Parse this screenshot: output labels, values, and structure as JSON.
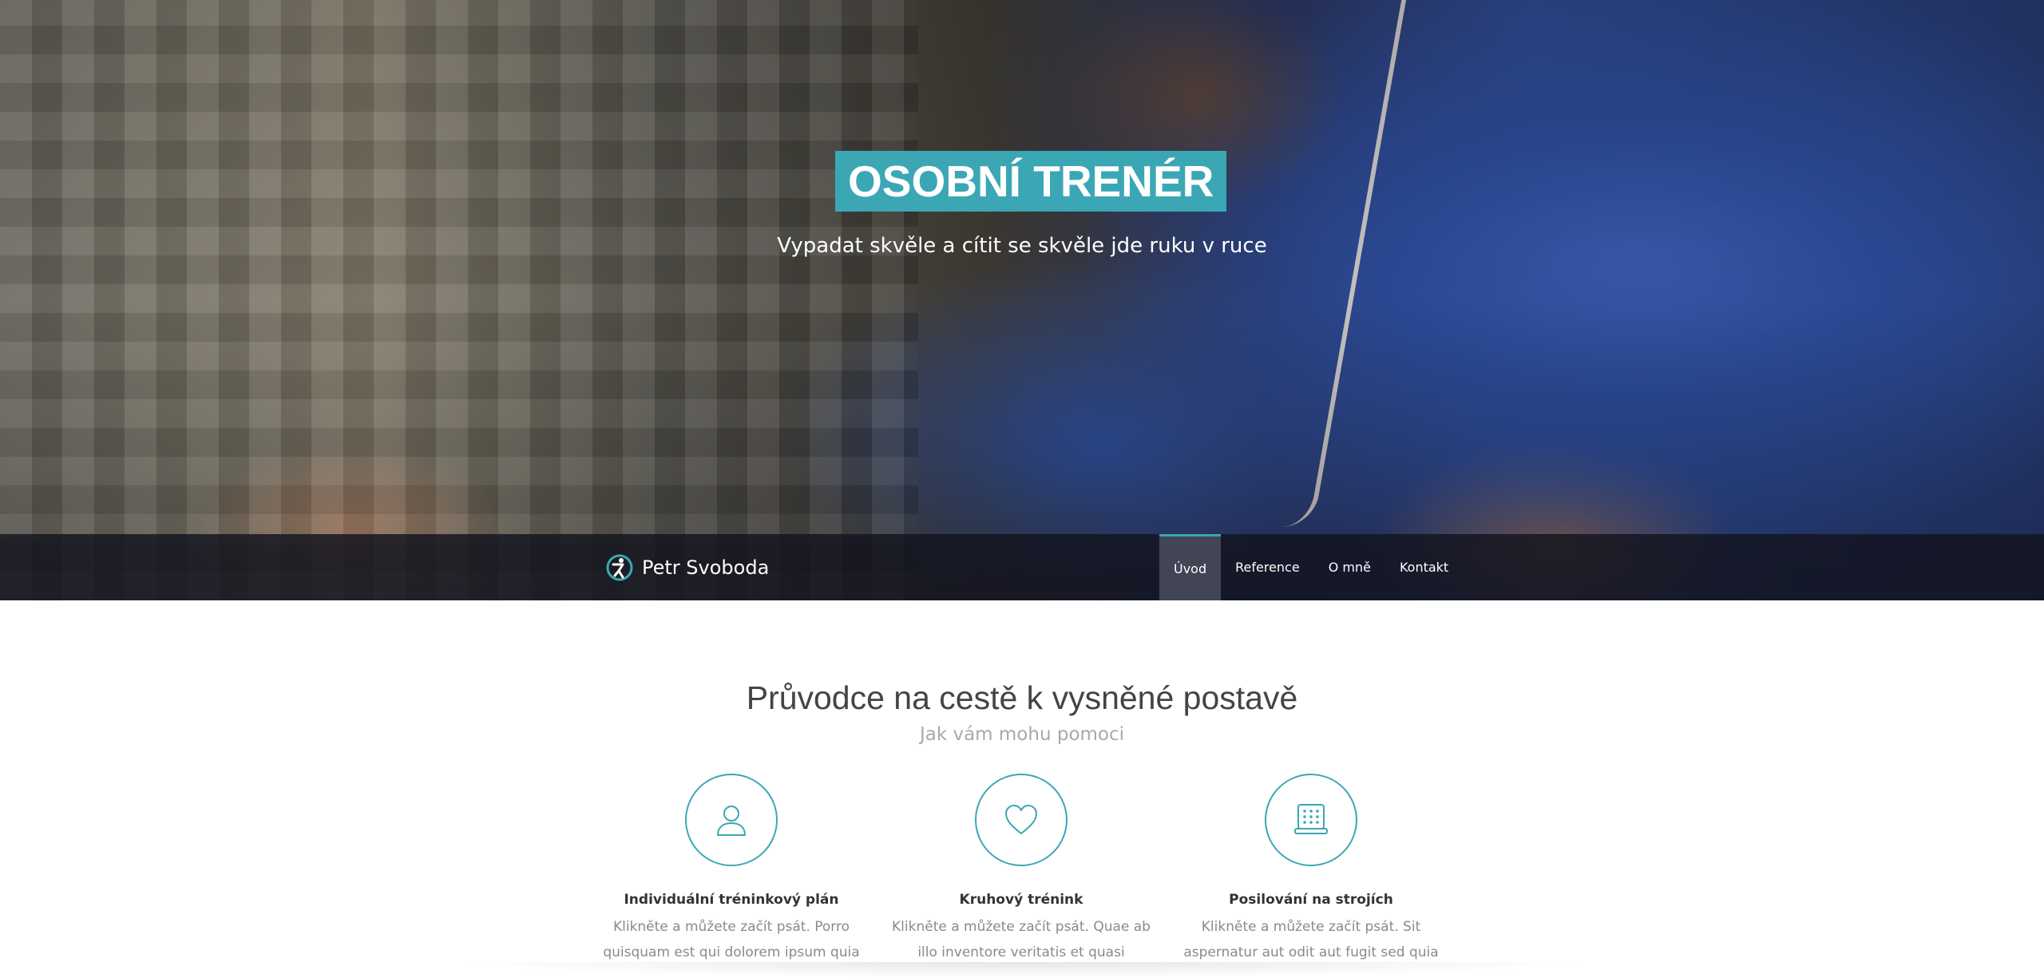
{
  "hero": {
    "title": "OSOBNÍ TRENÉR",
    "subtitle": "Vypadat skvěle a cítit se skvěle jde ruku v ruce"
  },
  "navbar": {
    "brand": "Petr Svoboda",
    "brand_icon": "runner-logo-icon",
    "items": [
      {
        "label": "Úvod",
        "active": true
      },
      {
        "label": "Reference",
        "active": false
      },
      {
        "label": "O mně",
        "active": false
      },
      {
        "label": "Kontakt",
        "active": false
      }
    ]
  },
  "section": {
    "title": "Průvodce na cestě k vysněné postavě",
    "subtitle": "Jak vám mohu pomoci"
  },
  "features": [
    {
      "icon": "user-icon",
      "title": "Individuální tréninkový plán",
      "text": "Klikněte a můžete začít psát. Porro quisquam est qui dolorem ipsum quia"
    },
    {
      "icon": "heart-icon",
      "title": "Kruhový trénink",
      "text": "Klikněte a můžete začít psát. Quae ab illo inventore veritatis et quasi"
    },
    {
      "icon": "machine-icon",
      "title": "Posilování na strojích",
      "text": "Klikněte a můžete začít psát. Sit aspernatur aut odit aut fugit sed quia"
    }
  ],
  "colors": {
    "accent": "#3ba7b5",
    "navbar": "#12141e",
    "heading": "#444444",
    "muted": "#a9a9a9"
  }
}
